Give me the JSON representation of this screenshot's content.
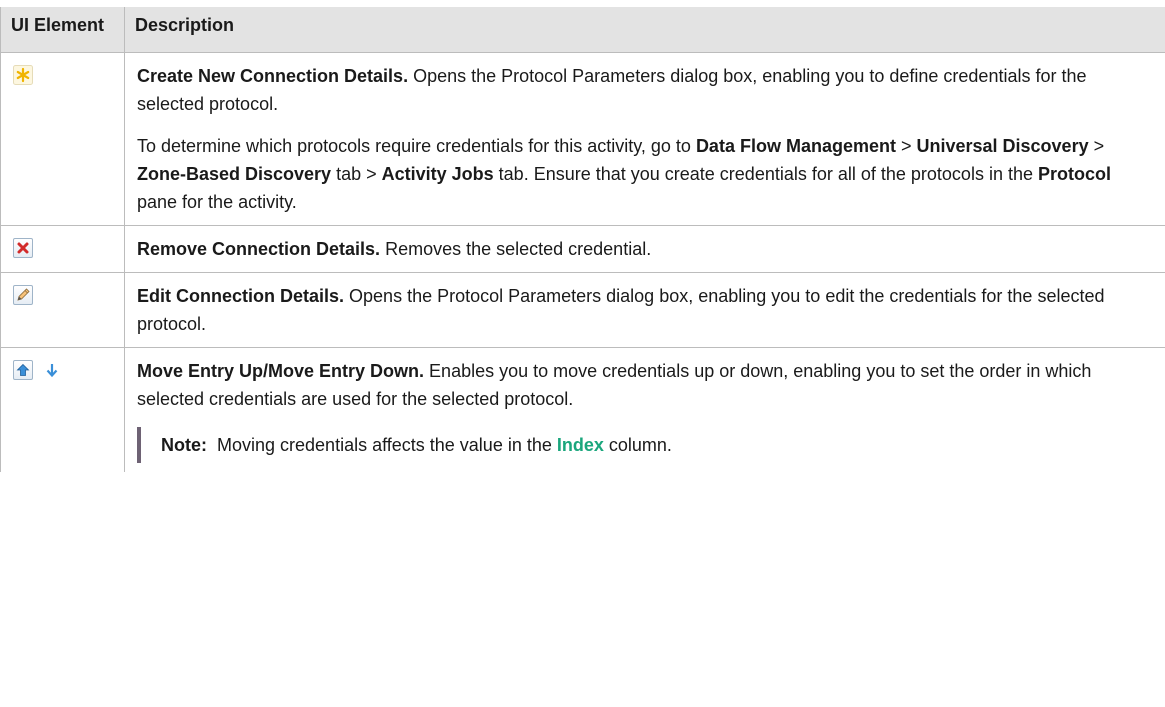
{
  "header": {
    "col1": "UI Element",
    "col2": "Description"
  },
  "rows": [
    {
      "icons": [
        "create-new-asterisk-icon"
      ],
      "title": "Create New Connection Details.",
      "desc": " Opens the Protocol Parameters dialog box, enabling you to define credentials for the selected protocol.",
      "para2": {
        "t1": "To determine which protocols require credentials for this activity, go to ",
        "k1": "Data Flow Management",
        "s1": " > ",
        "k2": "Universal Discovery",
        "s2": " > ",
        "k3": "Zone-Based Discovery",
        "s3": " tab > ",
        "k4": "Activity Jobs",
        "s4": " tab. Ensure that you create credentials for all of the protocols in the ",
        "k5": "Protocol",
        "s5": " pane for the activity."
      }
    },
    {
      "icons": [
        "remove-x-icon"
      ],
      "title": "Remove Connection Details.",
      "desc": " Removes the selected credential."
    },
    {
      "icons": [
        "edit-pencil-icon"
      ],
      "title": "Edit Connection Details.",
      "desc": " Opens the Protocol Parameters dialog box, enabling you to edit the credentials for the selected protocol."
    },
    {
      "icons": [
        "move-up-arrow-icon",
        "move-down-arrow-icon"
      ],
      "title": "Move Entry Up/Move Entry Down.",
      "desc": " Enables you to move credentials up or down, enabling you to set the order in which selected credentials are used for the selected protocol.",
      "note": {
        "label": "Note:",
        "t1": "  Moving credentials affects the value in the ",
        "k1": "Index",
        "t2": " column."
      }
    }
  ],
  "colors": {
    "header_bg": "#e3e3e3",
    "border": "#bcbcbc",
    "index_link": "#1aa67c",
    "note_bar": "#6e6274",
    "remove_red": "#d22b2b",
    "asterisk_yellow": "#f0b400"
  }
}
